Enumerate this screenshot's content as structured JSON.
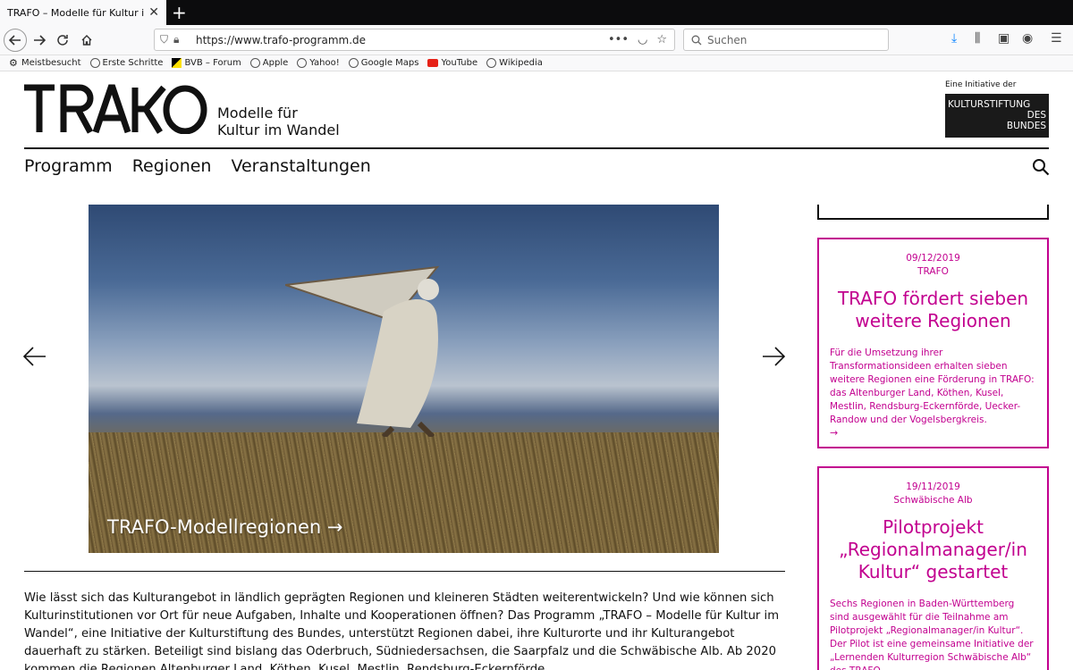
{
  "browser": {
    "tab_title": "TRAFO – Modelle für Kultur im Wandel",
    "tab_close": "✕",
    "new_tab": "+",
    "url": "https://www.trafo-programm.de",
    "url_actions": "•••",
    "search_placeholder": "Suchen",
    "bookmarks": [
      {
        "label": "Meistbesucht",
        "icon": "gear-icon"
      },
      {
        "label": "Erste Schritte",
        "icon": "globe-icon"
      },
      {
        "label": "BVB – Forum",
        "icon": "bvb-icon"
      },
      {
        "label": "Apple",
        "icon": "globe-icon"
      },
      {
        "label": "Yahoo!",
        "icon": "globe-icon"
      },
      {
        "label": "Google Maps",
        "icon": "globe-icon"
      },
      {
        "label": "YouTube",
        "icon": "youtube-icon"
      },
      {
        "label": "Wikipedia",
        "icon": "globe-icon"
      }
    ]
  },
  "header": {
    "logo": "TRAKO",
    "tagline_line1": "Modelle für",
    "tagline_line2": "Kultur im Wandel",
    "initiative_label": "Eine Initiative der",
    "ksb_line1": "KULTURSTIFTUNG",
    "ksb_line2": "DES",
    "ksb_line3": "BUNDES"
  },
  "nav": {
    "items": [
      "Programm",
      "Regionen",
      "Veranstaltungen"
    ]
  },
  "hero": {
    "caption": "TRAFO-Modellregionen →"
  },
  "intro": {
    "text": "Wie lässt sich das Kulturangebot in ländlich geprägten Regionen und kleineren Städten weiterentwickeln? Und wie können sich Kulturinstitutionen vor Ort für neue Aufgaben, Inhalte und Kooperationen öffnen? Das Programm „TRAFO – Modelle für Kultur im Wandel“, eine Initiative der Kulturstiftung des Bundes, unterstützt Regionen dabei, ihre Kulturorte und ihr Kulturangebot dauerhaft zu stärken. Beteiligt sind bislang das Oderbruch, Südniedersachsen, die Saarpfalz und die Schwäbische Alb. Ab 2020 kommen die Regionen Altenburger Land, Köthen, Kusel, Mestlin, Rendsburg-Eckernförde,"
  },
  "news": [
    {
      "date": "09/12/2019",
      "category": "TRAFO",
      "title": "TRAFO fördert sieben weitere Regionen",
      "body": "Für die Umsetzung ihrer Transformationsideen erhalten sieben weitere Regionen eine Förderung in TRAFO: das Altenburger Land, Köthen, Kusel, Mestlin, Rendsburg-Eckernförde, Uecker-Randow und der Vogelsbergkreis.",
      "more": "→"
    },
    {
      "date": "19/11/2019",
      "category": "Schwäbische Alb",
      "title": "Pilotprojekt „Regionalmanager/in Kultur“ gestartet",
      "body": "Sechs Regionen in Baden-Württemberg sind ausgewählt für die Teilnahme am Pilotprojekt „Regionalmanager/in Kultur“. Der Pilot ist eine gemeinsame Initiative der „Lernenden Kulturregion Schwäbische Alb“ des TRAFO-"
    }
  ],
  "colors": {
    "accent": "#c2008f",
    "text": "#111111"
  }
}
